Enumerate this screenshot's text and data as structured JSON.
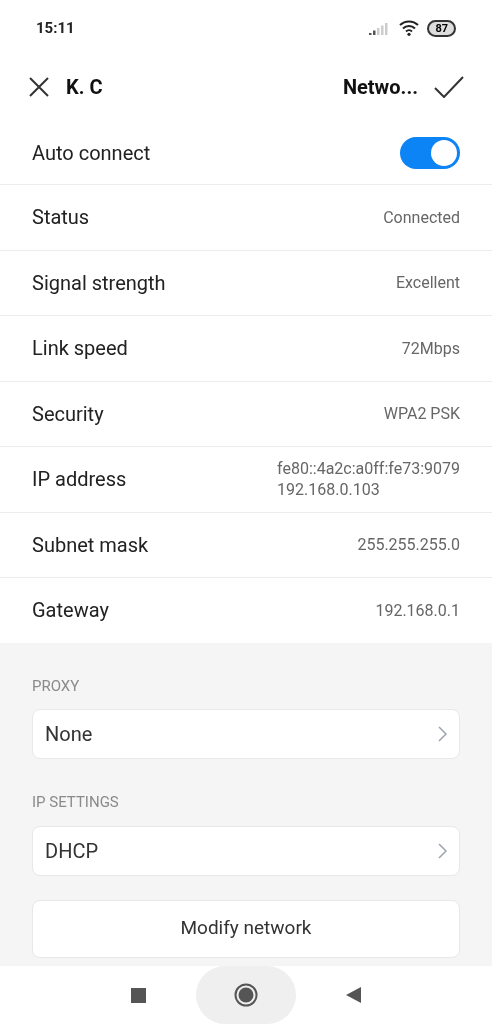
{
  "status_bar": {
    "time": "15:11",
    "battery": "87"
  },
  "header": {
    "title_parts": [
      "K. C",
      "Netwo..."
    ]
  },
  "auto_connect": {
    "label": "Auto connect",
    "on": true
  },
  "details": [
    {
      "label": "Status",
      "values": [
        "Connected"
      ]
    },
    {
      "label": "Signal strength",
      "values": [
        "Excellent"
      ]
    },
    {
      "label": "Link speed",
      "values": [
        "72Mbps"
      ]
    },
    {
      "label": "Security",
      "values": [
        "WPA2 PSK"
      ]
    },
    {
      "label": "IP address",
      "values": [
        "fe80::4a2c:a0ff:fe73:9079",
        "192.168.0.103"
      ]
    },
    {
      "label": "Subnet mask",
      "values": [
        "255.255.255.0"
      ]
    },
    {
      "label": "Gateway",
      "values": [
        "192.168.0.1"
      ]
    }
  ],
  "proxy": {
    "heading": "PROXY",
    "value": "None"
  },
  "ip_settings": {
    "heading": "IP SETTINGS",
    "value": "DHCP"
  },
  "modify_button": "Modify network"
}
